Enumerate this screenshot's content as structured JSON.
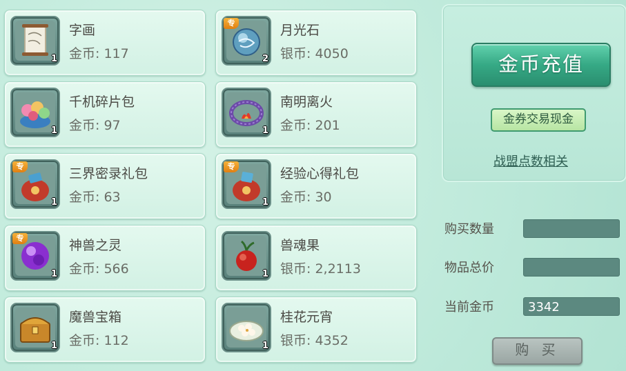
{
  "items": [
    {
      "name": "字画",
      "price": "金币: 117",
      "qty": "1",
      "special": "",
      "icon": "scroll-painting-icon"
    },
    {
      "name": "月光石",
      "price": "银币: 4050",
      "qty": "2",
      "special": "专",
      "icon": "moonstone-icon"
    },
    {
      "name": "千机碎片包",
      "price": "金币: 97",
      "qty": "1",
      "special": "",
      "icon": "fragment-pack-icon"
    },
    {
      "name": "南明离火",
      "price": "金币: 201",
      "qty": "1",
      "special": "",
      "icon": "fire-ring-icon"
    },
    {
      "name": "三界密录礼包",
      "price": "金币: 63",
      "qty": "1",
      "special": "专",
      "icon": "gift-bag-icon"
    },
    {
      "name": "经验心得礼包",
      "price": "金币: 30",
      "qty": "1",
      "special": "专",
      "icon": "gift-bag-icon"
    },
    {
      "name": "神兽之灵",
      "price": "金币: 566",
      "qty": "1",
      "special": "专",
      "icon": "purple-orb-icon"
    },
    {
      "name": "兽魂果",
      "price": "银币: 2,2113",
      "qty": "1",
      "special": "",
      "icon": "red-fruit-icon"
    },
    {
      "name": "魔兽宝箱",
      "price": "金币: 112",
      "qty": "1",
      "special": "",
      "icon": "treasure-chest-icon"
    },
    {
      "name": "桂花元宵",
      "price": "银币: 4352",
      "qty": "1",
      "special": "",
      "icon": "rice-balls-icon"
    }
  ],
  "panel": {
    "recharge_label": "金币充值",
    "voucher_label": "金券交易现金",
    "alliance_label": "战盟点数相关",
    "buy_qty_label": "购买数量",
    "total_price_label": "物品总价",
    "current_gold_label": "当前金币",
    "buy_qty_value": "",
    "total_price_value": "",
    "current_gold_value": "3342",
    "buy_label": "购 买"
  }
}
